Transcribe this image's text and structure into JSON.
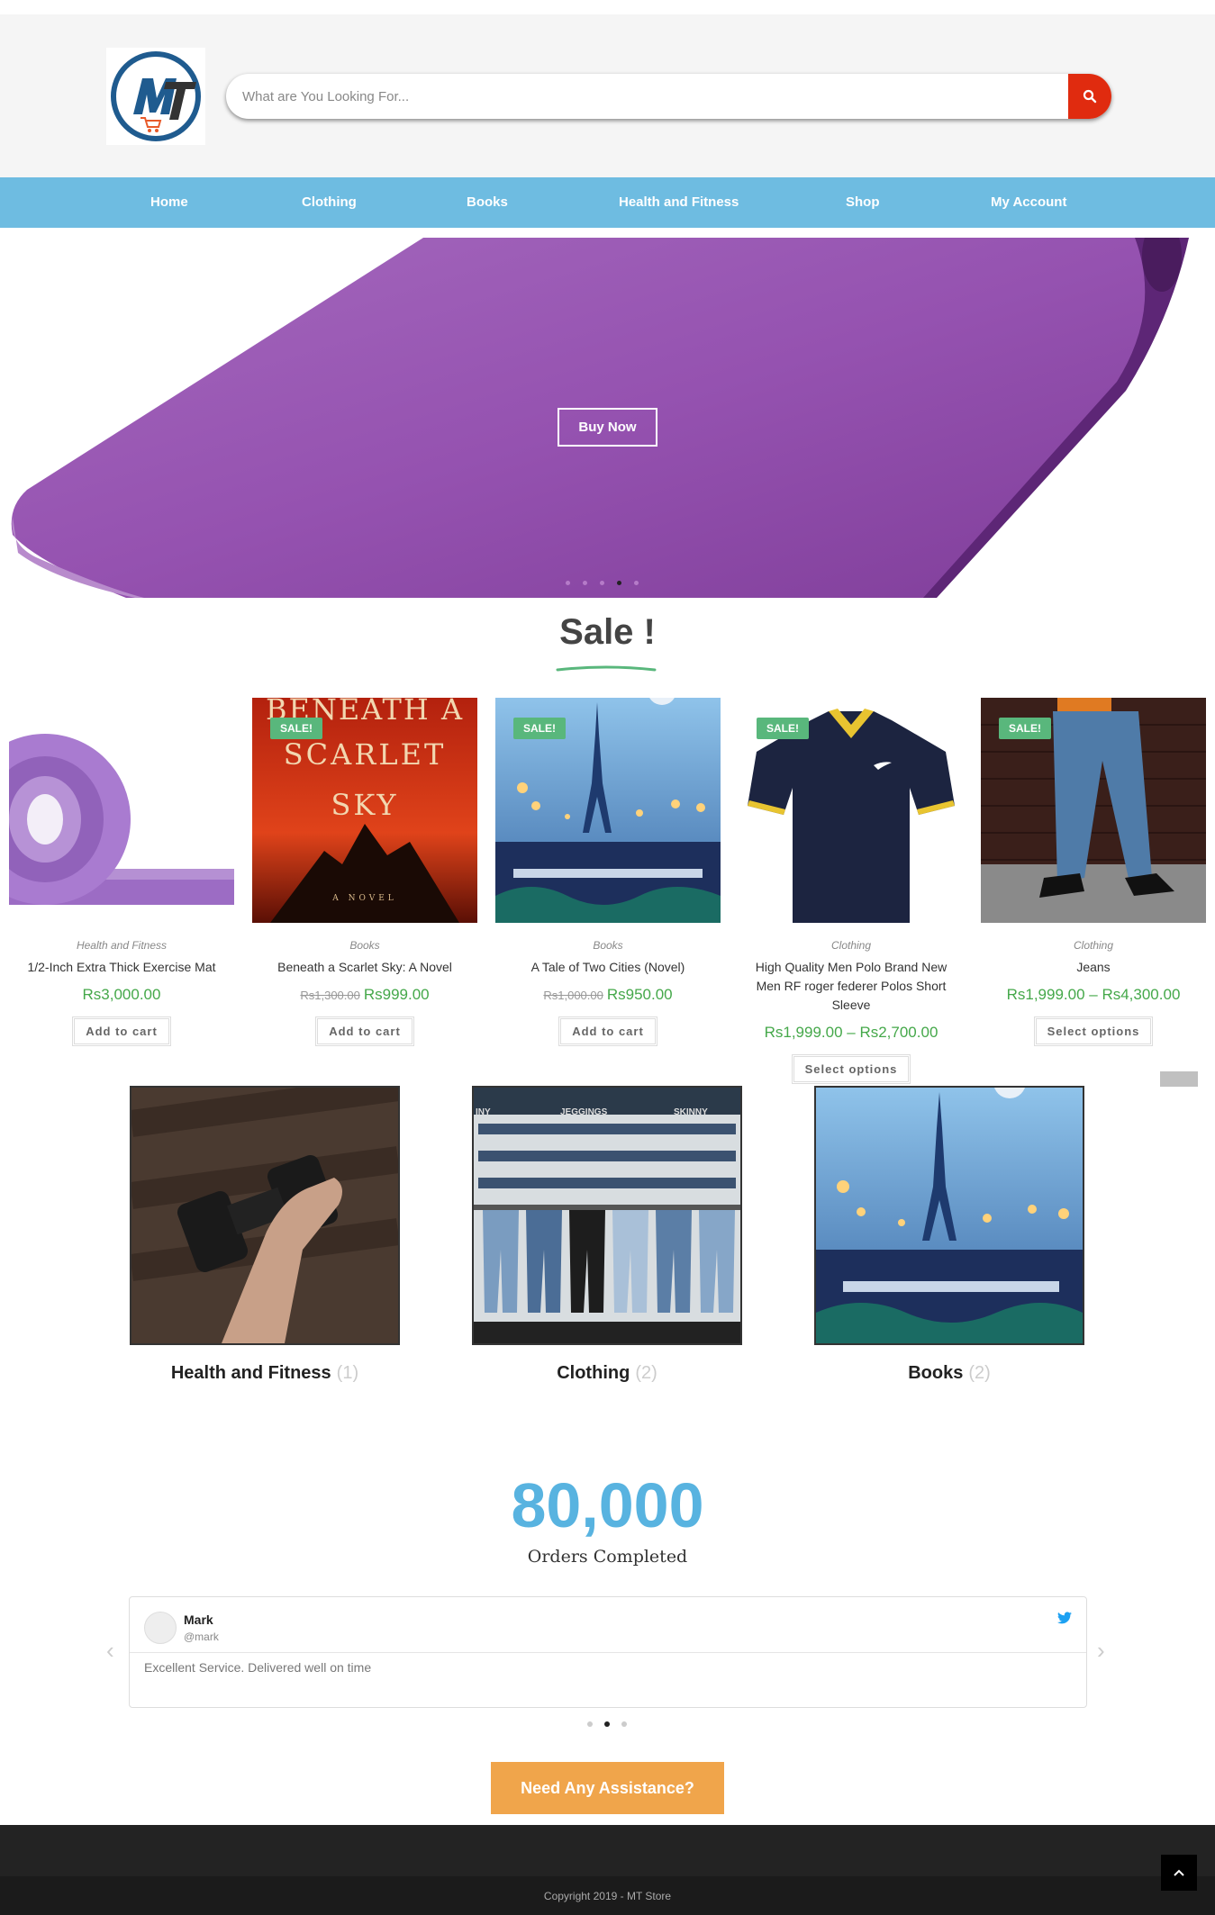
{
  "header": {
    "logo_text": "MT",
    "search_placeholder": "What are You Looking For...",
    "search_icon": "search-icon"
  },
  "nav": {
    "items": [
      {
        "label": "Home"
      },
      {
        "label": "Clothing"
      },
      {
        "label": "Books"
      },
      {
        "label": "Health and Fitness"
      },
      {
        "label": "Shop"
      },
      {
        "label": "My Account"
      }
    ]
  },
  "hero": {
    "button_label": "Buy Now",
    "slide_count": 5,
    "active_slide": 4
  },
  "sale_section": {
    "title": "Sale !",
    "products": [
      {
        "category": "Health and Fitness",
        "name": "1/2-Inch Extra Thick Exercise Mat",
        "old_price": "",
        "price": "Rs3,000.00",
        "button": "Add to cart",
        "badge": ""
      },
      {
        "category": "Books",
        "name": "Beneath a Scarlet Sky: A Novel",
        "old_price": "Rs1,300.00",
        "price": "Rs999.00",
        "button": "Add to cart",
        "badge": "SALE!",
        "cover_line1": "BENEATH A",
        "cover_line2": "SCARLET",
        "cover_line3": "SKY",
        "cover_line4": "A NOVEL"
      },
      {
        "category": "Books",
        "name": "A Tale of Two Cities (Novel)",
        "old_price": "Rs1,000.00",
        "price": "Rs950.00",
        "button": "Add to cart",
        "badge": "SALE!"
      },
      {
        "category": "Clothing",
        "name": "High Quality Men Polo Brand New Men RF roger federer Polos Short Sleeve",
        "old_price": "",
        "price": "Rs1,999.00 – Rs2,700.00",
        "button": "Select options",
        "badge": "SALE!"
      },
      {
        "category": "Clothing",
        "name": "Jeans",
        "old_price": "",
        "price": "Rs1,999.00 – Rs4,300.00",
        "button": "Select options",
        "badge": "SALE!"
      }
    ]
  },
  "categories": [
    {
      "title": "Health and Fitness",
      "count": "(1)"
    },
    {
      "title": "Clothing",
      "count": "(2)",
      "sign1": "INY",
      "sign2": "JEGGINGS",
      "sign3": "SKINNY"
    },
    {
      "title": "Books",
      "count": "(2)"
    }
  ],
  "counter": {
    "value": "80,000",
    "label": "Orders Completed"
  },
  "testimonial": {
    "name": "Mark",
    "handle": "@mark",
    "text": "Excellent Service. Delivered well on time",
    "slide_count": 3,
    "active_slide": 2
  },
  "cta": {
    "label": "Need Any Assistance?"
  },
  "footer": {
    "copyright": "Copyright 2019 - MT Store"
  },
  "colors": {
    "nav": "#6ebce1",
    "search_button": "#e02b0f",
    "sale_badge": "#59b77c",
    "price": "#45a84a",
    "counter": "#58b3e0",
    "cta": "#f0a54b",
    "footer": "#232323"
  }
}
